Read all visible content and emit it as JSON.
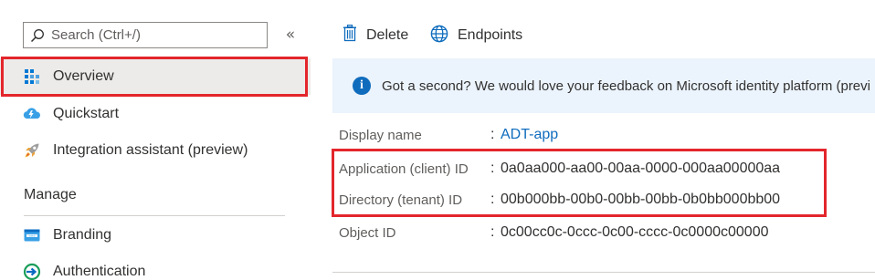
{
  "search": {
    "placeholder": "Search (Ctrl+/)",
    "icon": "search-icon"
  },
  "collapse_glyph": "«",
  "sidebar": {
    "items": [
      {
        "label": "Overview",
        "icon": "overview-grid-icon",
        "selected": true
      },
      {
        "label": "Quickstart",
        "icon": "quickstart-cloud-icon"
      },
      {
        "label": "Integration assistant (preview)",
        "icon": "rocket-icon"
      }
    ],
    "section": "Manage",
    "manage_items": [
      {
        "label": "Branding",
        "icon": "branding-icon"
      },
      {
        "label": "Authentication",
        "icon": "authentication-icon"
      }
    ]
  },
  "toolbar": {
    "delete_label": "Delete",
    "endpoints_label": "Endpoints"
  },
  "banner": {
    "icon": "info-icon",
    "text": "Got a second? We would love your feedback on Microsoft identity platform (previ"
  },
  "essentials": {
    "display_name_label": "Display name",
    "display_name_value": "ADT-app",
    "app_id_label": "Application (client) ID",
    "app_id_value": "0a0aa000-aa00-00aa-0000-000aa00000aa",
    "dir_id_label": "Directory (tenant) ID",
    "dir_id_value": "00b000bb-00b0-00bb-00bb-0b0bb000bb00",
    "object_id_label": "Object ID",
    "object_id_value": "0c00cc0c-0ccc-0c00-cccc-0c0000c00000",
    "separator": ":"
  },
  "colors": {
    "accent": "#0f6cbd",
    "highlight": "#e3262c",
    "banner_bg": "#ebf3fc",
    "selected_bg": "#edebe9"
  }
}
